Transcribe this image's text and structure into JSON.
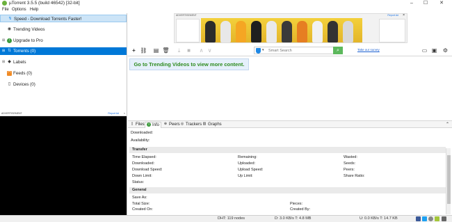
{
  "window": {
    "title": "µTorrent 3.5.5  (build 46542) [32-bit]"
  },
  "menu": [
    "File",
    "Options",
    "Help"
  ],
  "sidebar": {
    "items": [
      {
        "label": "Speed - Download Torrents Faster!",
        "icon": "lightning-icon"
      },
      {
        "label": "Trending Videos",
        "icon": "eye-icon"
      },
      {
        "label": "Upgrade to Pro",
        "icon": "upgrade-icon"
      },
      {
        "label": "Torrents (0)",
        "icon": "torrents-icon"
      },
      {
        "label": "Labels",
        "icon": "tag-icon"
      },
      {
        "label": "Feeds (0)",
        "icon": "rss-icon"
      },
      {
        "label": "Devices (0)",
        "icon": "device-icon"
      }
    ]
  },
  "ad_small": {
    "label": "ADVERTISEMENT",
    "report": "Report Ad"
  },
  "ad_banner": {
    "label": "ADVERTISEMENT",
    "report": "Report Ad"
  },
  "toolbar": {
    "search_placeholder": "Smart Search",
    "survey_link": "Take our survey"
  },
  "banner": {
    "text": "Go to Trending Videos to view more content."
  },
  "tabs": [
    {
      "label": "Files",
      "icon": "file-icon"
    },
    {
      "label": "Info",
      "icon": "info-icon"
    },
    {
      "label": "Peers",
      "icon": "peers-icon"
    },
    {
      "label": "Trackers",
      "icon": "trackers-icon"
    },
    {
      "label": "Graphs",
      "icon": "graphs-icon"
    }
  ],
  "info": {
    "top": [
      "Downloaded:",
      "Availability:"
    ],
    "transfer_title": "Transfer",
    "transfer_col1": [
      "Time Elapsed:",
      "Downloaded:",
      "Download Speed:",
      "Down Limit:",
      "Status:"
    ],
    "transfer_col2": [
      "Remaining:",
      "Uploaded:",
      "Upload Speed:",
      "Up Limit:"
    ],
    "transfer_col3": [
      "Wasted:",
      "Seeds:",
      "Peers:",
      "Share Ratio:"
    ],
    "general_title": "General",
    "general_col1": [
      "Save As:",
      "Total Size:",
      "Created On:"
    ],
    "general_col2": [
      "Pieces:",
      "Created By:"
    ]
  },
  "status": {
    "dht": "DHT: 119 nodes",
    "down": "D: 3.0 KB/s T: 4.8 MB",
    "up": "U: 0.0 KB/s T: 14.7 KB"
  },
  "colors": {
    "selected": "#0078d7",
    "banner_text": "#2e8b1e",
    "search_go": "#5cb85c"
  }
}
